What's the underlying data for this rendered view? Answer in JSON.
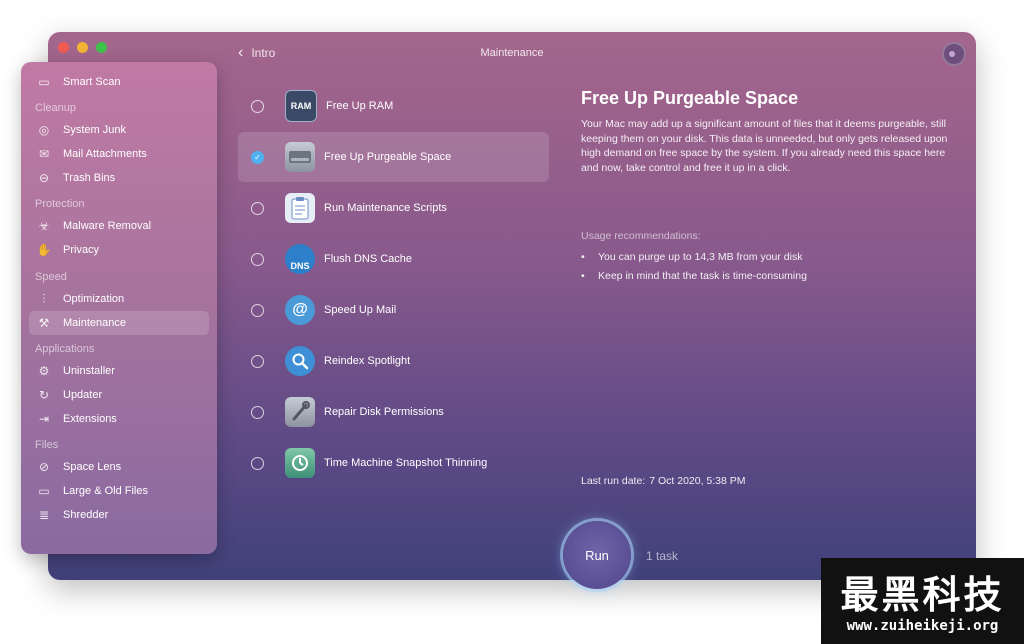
{
  "window": {
    "title": "Maintenance",
    "back_label": "Intro"
  },
  "sidebar": {
    "top_item": {
      "label": "Smart Scan",
      "icon": "monitor-icon"
    },
    "sections": [
      {
        "title": "Cleanup",
        "items": [
          {
            "label": "System Junk",
            "icon": "disc-icon"
          },
          {
            "label": "Mail Attachments",
            "icon": "envelope-icon"
          },
          {
            "label": "Trash Bins",
            "icon": "trash-icon"
          }
        ]
      },
      {
        "title": "Protection",
        "items": [
          {
            "label": "Malware Removal",
            "icon": "biohazard-icon"
          },
          {
            "label": "Privacy",
            "icon": "hand-icon"
          }
        ]
      },
      {
        "title": "Speed",
        "items": [
          {
            "label": "Optimization",
            "icon": "sliders-icon"
          },
          {
            "label": "Maintenance",
            "icon": "wrench-icon",
            "active": true
          }
        ]
      },
      {
        "title": "Applications",
        "items": [
          {
            "label": "Uninstaller",
            "icon": "uninstaller-icon"
          },
          {
            "label": "Updater",
            "icon": "updater-icon"
          },
          {
            "label": "Extensions",
            "icon": "extensions-icon"
          }
        ]
      },
      {
        "title": "Files",
        "items": [
          {
            "label": "Space Lens",
            "icon": "lens-icon"
          },
          {
            "label": "Large & Old Files",
            "icon": "folder-icon"
          },
          {
            "label": "Shredder",
            "icon": "shredder-icon"
          }
        ]
      }
    ]
  },
  "tasks": [
    {
      "label": "Free Up RAM",
      "icon": "ram-icon",
      "icon_text": "RAM",
      "checked": false
    },
    {
      "label": "Free Up Purgeable Space",
      "icon": "hard-drive-icon",
      "checked": true
    },
    {
      "label": "Run Maintenance Scripts",
      "icon": "clipboard-icon",
      "checked": false
    },
    {
      "label": "Flush DNS Cache",
      "icon": "dns-icon",
      "icon_text": "DNS",
      "checked": false
    },
    {
      "label": "Speed Up Mail",
      "icon": "mail-stamp-icon",
      "checked": false
    },
    {
      "label": "Reindex Spotlight",
      "icon": "magnifier-icon",
      "checked": false
    },
    {
      "label": "Repair Disk Permissions",
      "icon": "disk-wrench-icon",
      "checked": false
    },
    {
      "label": "Time Machine Snapshot Thinning",
      "icon": "time-machine-icon",
      "checked": false
    }
  ],
  "detail": {
    "title": "Free Up Purgeable Space",
    "description": "Your Mac may add up a significant amount of files that it deems purgeable, still keeping them on your disk. This data is unneeded, but only gets released upon high demand on free space by the system. If you already need this space here and now, take control and free it up in a click.",
    "usage_heading": "Usage recommendations:",
    "usage_items": [
      "You can purge up to 14,3 MB from your disk",
      "Keep in mind that the task is time-consuming"
    ],
    "last_run_label": "Last run date:",
    "last_run_value": "7 Oct 2020, 5:38 PM"
  },
  "footer": {
    "run_label": "Run",
    "task_count": "1 task"
  },
  "watermark": {
    "chinese": "最黑科技",
    "url": "www.zuiheikeji.org"
  },
  "colors": {
    "accent_check": "#4fb1f0",
    "window_top": "#a4668c",
    "window_bottom": "#40417a"
  }
}
